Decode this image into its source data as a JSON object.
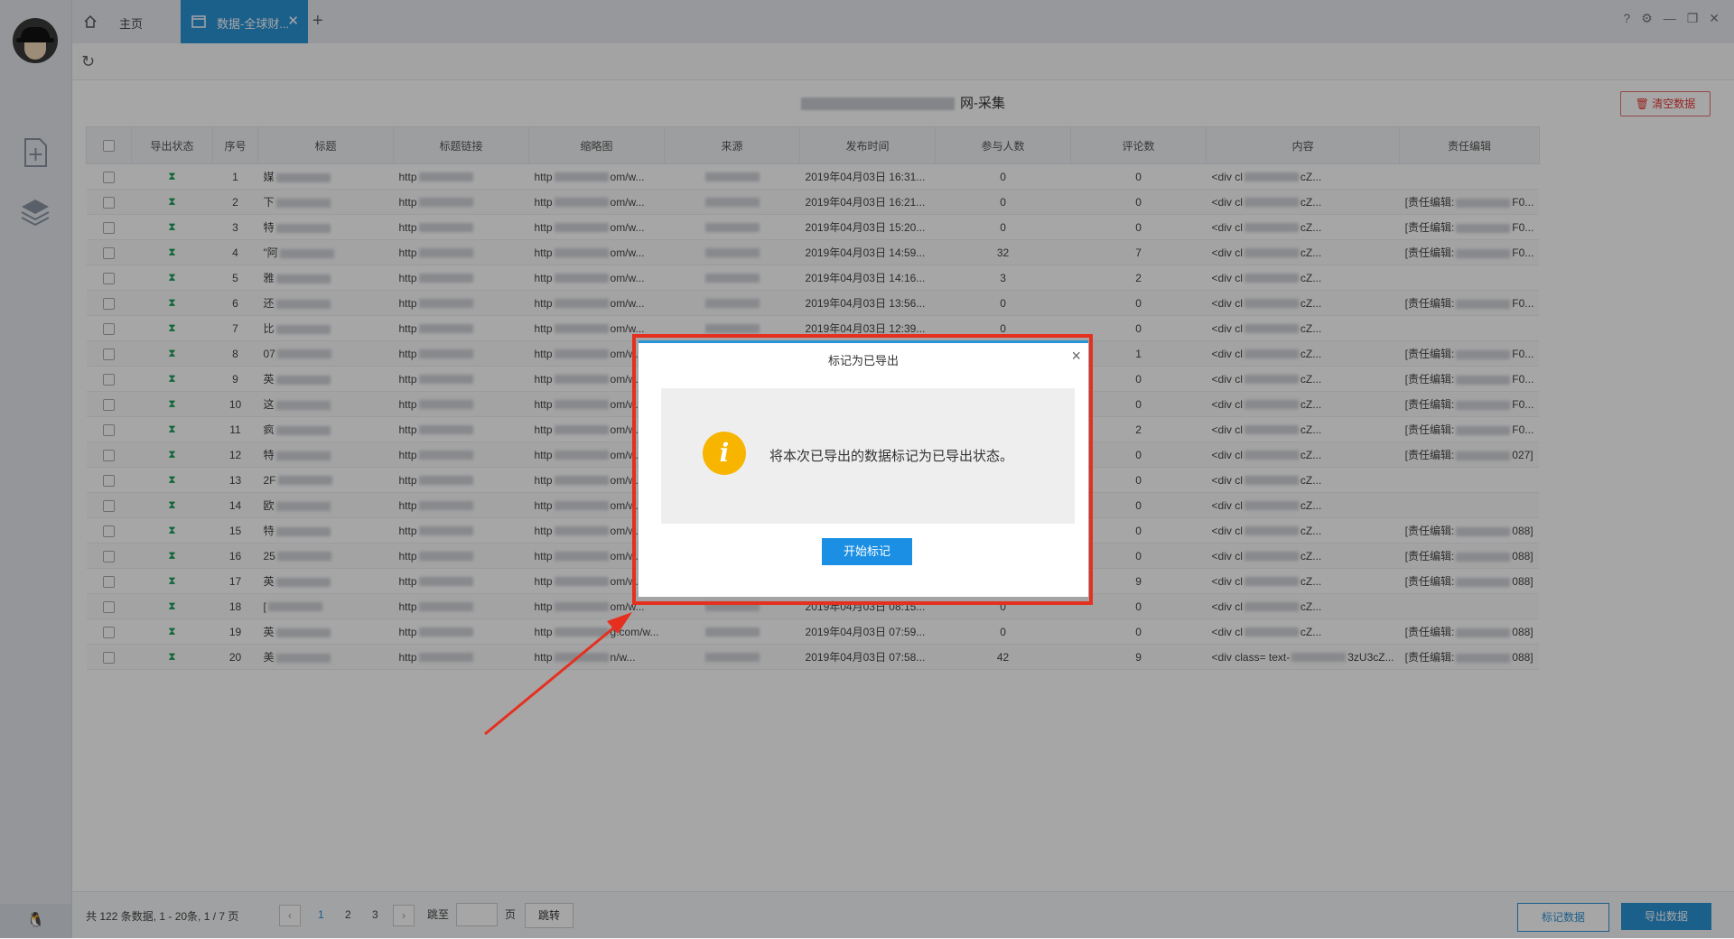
{
  "tabs": {
    "home_label": "主页",
    "active_label": "数据-全球财..."
  },
  "page_title_suffix": "网-采集",
  "clear_button": "清空数据",
  "table": {
    "headers": [
      "导出状态",
      "序号",
      "标题",
      "标题链接",
      "缩略图",
      "来源",
      "发布时间",
      "参与人数",
      "评论数",
      "内容",
      "责任编辑"
    ],
    "rows": [
      {
        "no": "1",
        "title": "媒",
        "link": "http",
        "thumb": "http",
        "thumb_tail": "om/w...",
        "time": "2019年04月03日 16:31...",
        "people": "0",
        "comments": "0",
        "content": "<div cl",
        "content_tail": "cZ...",
        "editor": ""
      },
      {
        "no": "2",
        "title": "下",
        "link": "http",
        "thumb": "http",
        "thumb_tail": "om/w...",
        "time": "2019年04月03日 16:21...",
        "people": "0",
        "comments": "0",
        "content": "<div cl",
        "content_tail": "cZ...",
        "editor": "[责任编辑:",
        "editor_tail": "F0..."
      },
      {
        "no": "3",
        "title": "特",
        "link": "http",
        "thumb": "http",
        "thumb_tail": "om/w...",
        "time": "2019年04月03日 15:20...",
        "people": "0",
        "comments": "0",
        "content": "<div cl",
        "content_tail": "cZ...",
        "editor": "[责任编辑:",
        "editor_tail": "F0..."
      },
      {
        "no": "4",
        "title": "\"阿",
        "link": "http",
        "thumb": "http",
        "thumb_tail": "om/w...",
        "time": "2019年04月03日 14:59...",
        "people": "32",
        "comments": "7",
        "content": "<div cl",
        "content_tail": "cZ...",
        "editor": "[责任编辑:",
        "editor_tail": "F0..."
      },
      {
        "no": "5",
        "title": "雅",
        "link": "http",
        "thumb": "http",
        "thumb_tail": "om/w...",
        "time": "2019年04月03日 14:16...",
        "people": "3",
        "comments": "2",
        "content": "<div cl",
        "content_tail": "cZ...",
        "editor": ""
      },
      {
        "no": "6",
        "title": "还",
        "link": "http",
        "thumb": "http",
        "thumb_tail": "om/w...",
        "time": "2019年04月03日 13:56...",
        "people": "0",
        "comments": "0",
        "content": "<div cl",
        "content_tail": "cZ...",
        "editor": "[责任编辑:",
        "editor_tail": "F0..."
      },
      {
        "no": "7",
        "title": "比",
        "link": "http",
        "thumb": "http",
        "thumb_tail": "om/w...",
        "time": "2019年04月03日 12:39...",
        "people": "0",
        "comments": "0",
        "content": "<div cl",
        "content_tail": "cZ...",
        "editor": ""
      },
      {
        "no": "8",
        "title": "07",
        "link": "http",
        "thumb": "http",
        "thumb_tail": "om/w...",
        "time": "",
        "people": "",
        "comments": "1",
        "content": "<div cl",
        "content_tail": "cZ...",
        "editor": "[责任编辑:",
        "editor_tail": "F0..."
      },
      {
        "no": "9",
        "title": "英",
        "link": "http",
        "thumb": "http",
        "thumb_tail": "om/w...",
        "time": "",
        "people": "",
        "comments": "0",
        "content": "<div cl",
        "content_tail": "cZ...",
        "editor": "[责任编辑:",
        "editor_tail": "F0..."
      },
      {
        "no": "10",
        "title": "这",
        "link": "http",
        "thumb": "http",
        "thumb_tail": "om/w...",
        "time": "",
        "people": "",
        "comments": "0",
        "content": "<div cl",
        "content_tail": "cZ...",
        "editor": "[责任编辑:",
        "editor_tail": "F0..."
      },
      {
        "no": "11",
        "title": "疯",
        "link": "http",
        "thumb": "http",
        "thumb_tail": "om/w...",
        "time": "",
        "people": "",
        "comments": "2",
        "content": "<div cl",
        "content_tail": "cZ...",
        "editor": "[责任编辑:",
        "editor_tail": "F0..."
      },
      {
        "no": "12",
        "title": "特",
        "link": "http",
        "thumb": "http",
        "thumb_tail": "om/w...",
        "time": "",
        "people": "",
        "comments": "0",
        "content": "<div cl",
        "content_tail": "cZ...",
        "editor": "[责任编辑:",
        "editor_tail": "027]"
      },
      {
        "no": "13",
        "title": "2F",
        "link": "http",
        "thumb": "http",
        "thumb_tail": "om/w...",
        "time": "",
        "people": "",
        "comments": "0",
        "content": "<div cl",
        "content_tail": "cZ...",
        "editor": ""
      },
      {
        "no": "14",
        "title": "欧",
        "link": "http",
        "thumb": "http",
        "thumb_tail": "om/w...",
        "time": "",
        "people": "",
        "comments": "0",
        "content": "<div cl",
        "content_tail": "cZ...",
        "editor": ""
      },
      {
        "no": "15",
        "title": "特",
        "link": "http",
        "thumb": "http",
        "thumb_tail": "om/w...",
        "time": "",
        "people": "",
        "comments": "0",
        "content": "<div cl",
        "content_tail": "cZ...",
        "editor": "[责任编辑:",
        "editor_tail": "088]"
      },
      {
        "no": "16",
        "title": "25",
        "link": "http",
        "thumb": "http",
        "thumb_tail": "om/w...",
        "time": "",
        "people": "",
        "comments": "0",
        "content": "<div cl",
        "content_tail": "cZ...",
        "editor": "[责任编辑:",
        "editor_tail": "088]"
      },
      {
        "no": "17",
        "title": "英",
        "link": "http",
        "thumb": "http",
        "thumb_tail": "om/w...",
        "time": "",
        "people": "",
        "comments": "9",
        "content": "<div cl",
        "content_tail": "cZ...",
        "editor": "[责任编辑:",
        "editor_tail": "088]"
      },
      {
        "no": "18",
        "title": "[",
        "link": "http",
        "thumb": "http",
        "thumb_tail": "om/w...",
        "time": "2019年04月03日 08:15...",
        "people": "0",
        "comments": "0",
        "content": "<div cl",
        "content_tail": "cZ...",
        "editor": ""
      },
      {
        "no": "19",
        "title": "英",
        "link": "http",
        "thumb": "http",
        "thumb_tail": "g.com/w...",
        "time": "2019年04月03日 07:59...",
        "people": "0",
        "comments": "0",
        "content": "<div cl",
        "content_tail": "cZ...",
        "editor": "[责任编辑:",
        "editor_tail": "088]"
      },
      {
        "no": "20",
        "title": "美",
        "link": "http",
        "thumb": "http",
        "thumb_tail": "n/w...",
        "time": "2019年04月03日 07:58...",
        "people": "42",
        "comments": "9",
        "content": "<div class= text-",
        "content_tail": "3zU3cZ...",
        "editor": "[责任编辑:",
        "editor_tail": "088]"
      }
    ]
  },
  "footer": {
    "info": "共 122 条数据, 1 - 20条, 1 / 7 页",
    "pages": [
      "1",
      "2",
      "3"
    ],
    "jump_label": "跳至",
    "page_unit": "页",
    "jump_button": "跳转",
    "mark_button": "标记数据",
    "export_button": "导出数据"
  },
  "dialog": {
    "title": "标记为已导出",
    "message": "将本次已导出的数据标记为已导出状态。",
    "start_button": "开始标记",
    "icon": "info-icon"
  },
  "colors": {
    "accent": "#2a93d6",
    "highlight": "#e53020",
    "warning": "#f7b500"
  }
}
